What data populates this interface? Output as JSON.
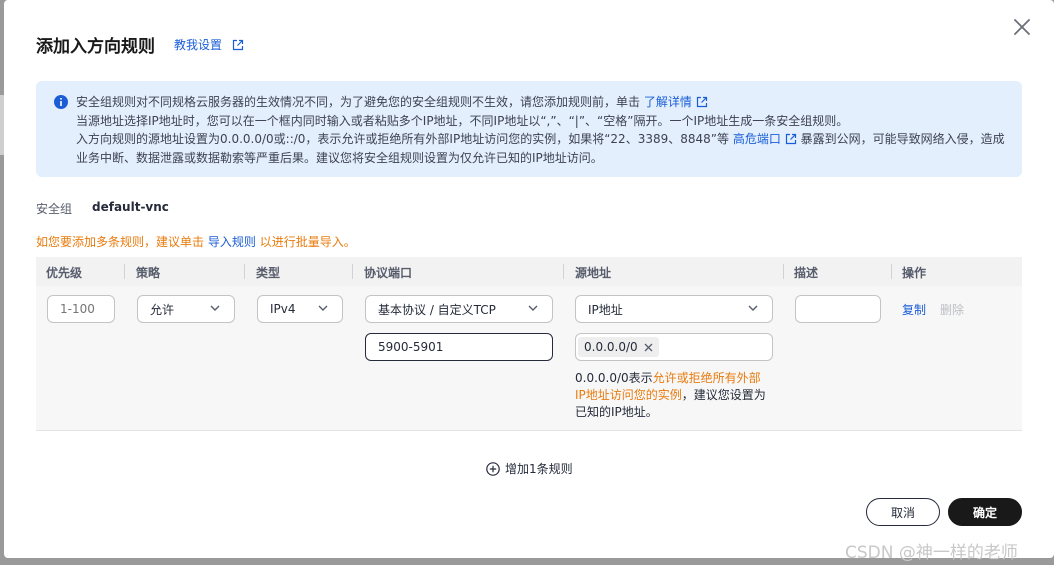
{
  "dialog": {
    "title": "添加入方向规则",
    "tutorial_link": "教我设置"
  },
  "notice": {
    "line1": "安全组规则对不同规格云服务器的生效情况不同，为了避免您的安全组规则不生效，请您添加规则前，单击",
    "line1_link": "了解详情",
    "line2": "当源地址选择IP地址时，您可以在一个框内同时输入或者粘贴多个IP地址，不同IP地址以“,”、“|”、“空格”隔开。一个IP地址生成一条安全组规则。",
    "line3a": "入方向规则的源地址设置为0.0.0.0/0或::/0，表示允许或拒绝所有外部IP地址访问您的实例，如果将“22、3389、8848”等",
    "line3_link": "高危端口",
    "line3b": "暴露到公网，可能导致网络入侵，造成",
    "line4": "业务中断、数据泄露或数据勒索等严重后果。建议您将安全组规则设置为仅允许已知的IP地址访问。"
  },
  "security_group": {
    "label": "安全组",
    "value": "default-vnc"
  },
  "tip": {
    "prefix": "如您要添加多条规则，建议单击",
    "link": "导入规则",
    "suffix": "以进行批量导入。"
  },
  "table": {
    "headers": {
      "priority": "优先级",
      "policy": "策略",
      "type": "类型",
      "protocol_port": "协议端口",
      "source": "源地址",
      "description": "描述",
      "actions": "操作"
    },
    "row": {
      "priority_placeholder": "1-100",
      "policy": "允许",
      "type": "IPv4",
      "protocol": "基本协议 / 自定义TCP",
      "port": "5900-5901",
      "source_type": "IP地址",
      "source_tag": "0.0.0.0/0",
      "source_hint_a": "0.0.0.0/0表示",
      "source_hint_warn": "允许或拒绝所有外部IP地址访问您的实例",
      "source_hint_b": "，建议您设置为已知的IP地址。",
      "copy": "复制",
      "delete": "删除"
    }
  },
  "add_rule": "增加1条规则",
  "buttons": {
    "cancel": "取消",
    "ok": "确定"
  },
  "watermark": "CSDN @神一样的老师",
  "colors": {
    "link": "#1a5ed6",
    "warning": "#e97b0d",
    "notice_bg": "#e3effd",
    "primary_button": "#191919"
  }
}
